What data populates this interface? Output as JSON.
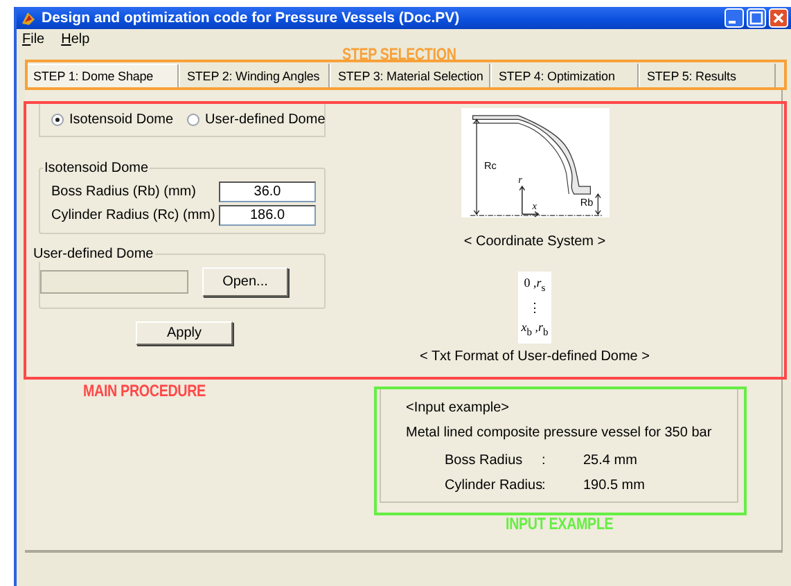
{
  "window": {
    "title": "Design and optimization code for Pressure Vessels (Doc.PV)"
  },
  "menu": [
    {
      "label": "File"
    },
    {
      "label": "Help"
    }
  ],
  "tabs": [
    {
      "label": "STEP 1: Dome Shape",
      "selected": true
    },
    {
      "label": "STEP 2: Winding Angles",
      "selected": false
    },
    {
      "label": "STEP 3: Material Selection",
      "selected": false
    },
    {
      "label": "STEP 4: Optimization",
      "selected": false
    },
    {
      "label": "STEP 5: Results",
      "selected": false
    }
  ],
  "dome_type": [
    {
      "label": "Isotensoid Dome",
      "selected": true
    },
    {
      "label": "User-defined Dome",
      "selected": false
    }
  ],
  "isotensoid": {
    "title": "Isotensoid Dome",
    "fields": [
      {
        "label": "Boss Radius (Rb) (mm)",
        "value": "36.0"
      },
      {
        "label": "Cylinder Radius (Rc) (mm)",
        "value": "186.0"
      }
    ]
  },
  "user_defined": {
    "title": "User-defined Dome",
    "open_button": "Open..."
  },
  "apply_button": "Apply",
  "coordinate_figure": {
    "labels": [
      "Rc",
      "r",
      "x",
      "Rb"
    ],
    "caption": "< Coordinate System >"
  },
  "format_figure": {
    "lines": [
      "0 ,*r*$_{s}$",
      "⋮",
      "*x*$_{b}$ ,*r*$_{b}$"
    ],
    "caption": "< Txt Format of User-defined Dome  >"
  },
  "example": {
    "heading": "<Input example>",
    "description": "Metal lined composite pressure vessel for 350 bar",
    "rows": [
      {
        "label": "Boss Radius",
        "separator": ":",
        "value": "25.4 mm"
      },
      {
        "label": "Cylinder Radius",
        "separator": ":",
        "value": "190.5 mm"
      }
    ]
  },
  "annotations": [
    {
      "label": "STEP SELECTION",
      "color": "#f7a13a"
    },
    {
      "label": "MAIN PROCEDURE",
      "color": "#ff4848"
    },
    {
      "label": "INPUT EXAMPLE",
      "color": "#66ee44"
    }
  ]
}
